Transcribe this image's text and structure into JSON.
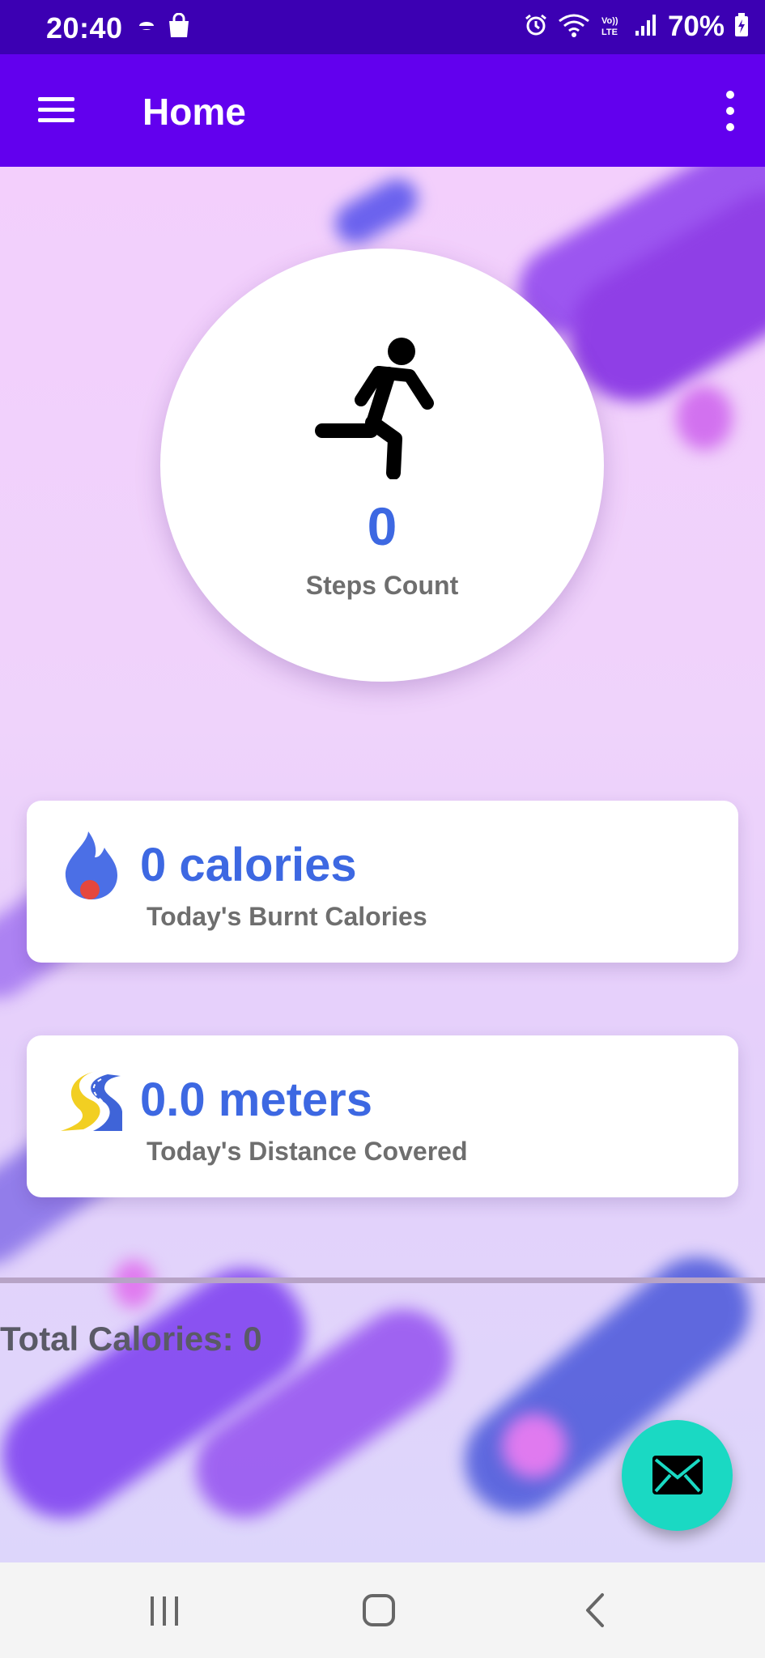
{
  "status_bar": {
    "time": "20:40",
    "battery": "70%",
    "icons": [
      "weather-icon",
      "shopping-bag-icon",
      "alarm-icon",
      "wifi-icon",
      "volte-icon",
      "signal-icon",
      "battery-icon"
    ]
  },
  "app_bar": {
    "title": "Home",
    "menu_icon": "hamburger-menu-icon",
    "overflow_icon": "more-vert-icon"
  },
  "steps": {
    "icon": "running-person-icon",
    "value": "0",
    "label": "Steps Count"
  },
  "cards": [
    {
      "icon": "flame-icon",
      "value": "0 calories",
      "label": "Today's Burnt Calories"
    },
    {
      "icon": "road-icon",
      "value": "0.0 meters",
      "label": "Today's Distance Covered"
    }
  ],
  "total_calories": "Total Calories: 0",
  "fab": {
    "icon": "mail-icon"
  },
  "nav_bar": {
    "items": [
      "recent-apps-icon",
      "home-icon",
      "back-icon"
    ]
  },
  "colors": {
    "status_bar": "#3c00b3",
    "app_bar": "#6200ee",
    "accent_value": "#3d68e2",
    "fab": "#1ad9c3"
  }
}
